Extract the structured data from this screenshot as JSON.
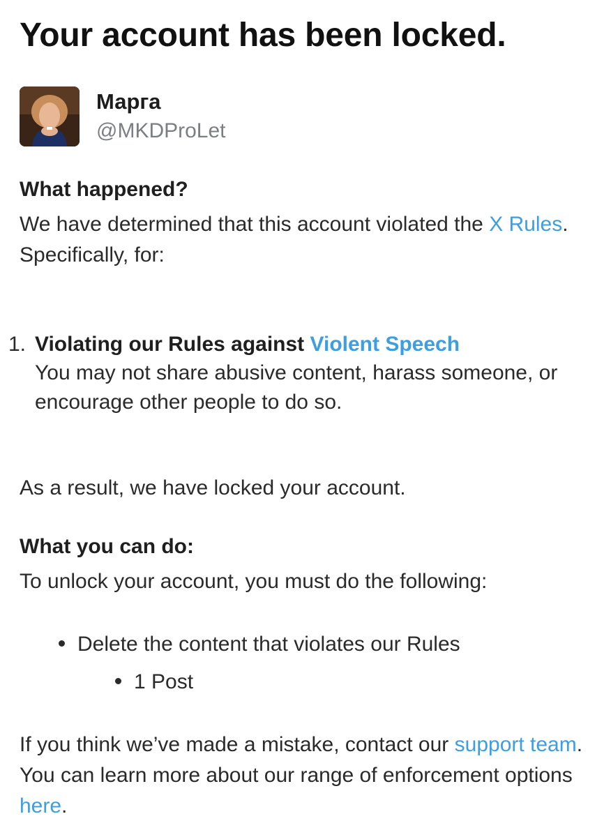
{
  "title": "Your account has been locked.",
  "profile": {
    "display_name": "Марга",
    "handle": "@MKDProLet",
    "avatar_icon": "profile-photo"
  },
  "what_happened": {
    "heading": "What happened?",
    "text_before": "We have determined that this account violated the ",
    "rules_link": "X Rules",
    "text_after": ". Specifically, for:"
  },
  "violations": [
    {
      "number": "1.",
      "title_prefix": "Violating our Rules against ",
      "policy_link": "Violent Speech",
      "description": "You may not share abusive content, harass someone, or encourage other people to do so."
    }
  ],
  "result_text": "As a result, we have locked your account.",
  "what_you_can_do": {
    "heading": "What you can do:",
    "intro": "To unlock your account, you must do the following:",
    "steps": [
      {
        "label": "Delete the content that violates our Rules",
        "subitems": [
          "1 Post"
        ]
      }
    ]
  },
  "footer": {
    "text_1": "If you think we’ve made a mistake, contact our ",
    "support_link": "support team",
    "text_2": ". You can learn more about our range of enforcement options ",
    "here_link": "here",
    "text_3": "."
  },
  "colors": {
    "link": "#3d9ee0",
    "text": "#1f1f1f",
    "muted": "#7b7f84"
  }
}
